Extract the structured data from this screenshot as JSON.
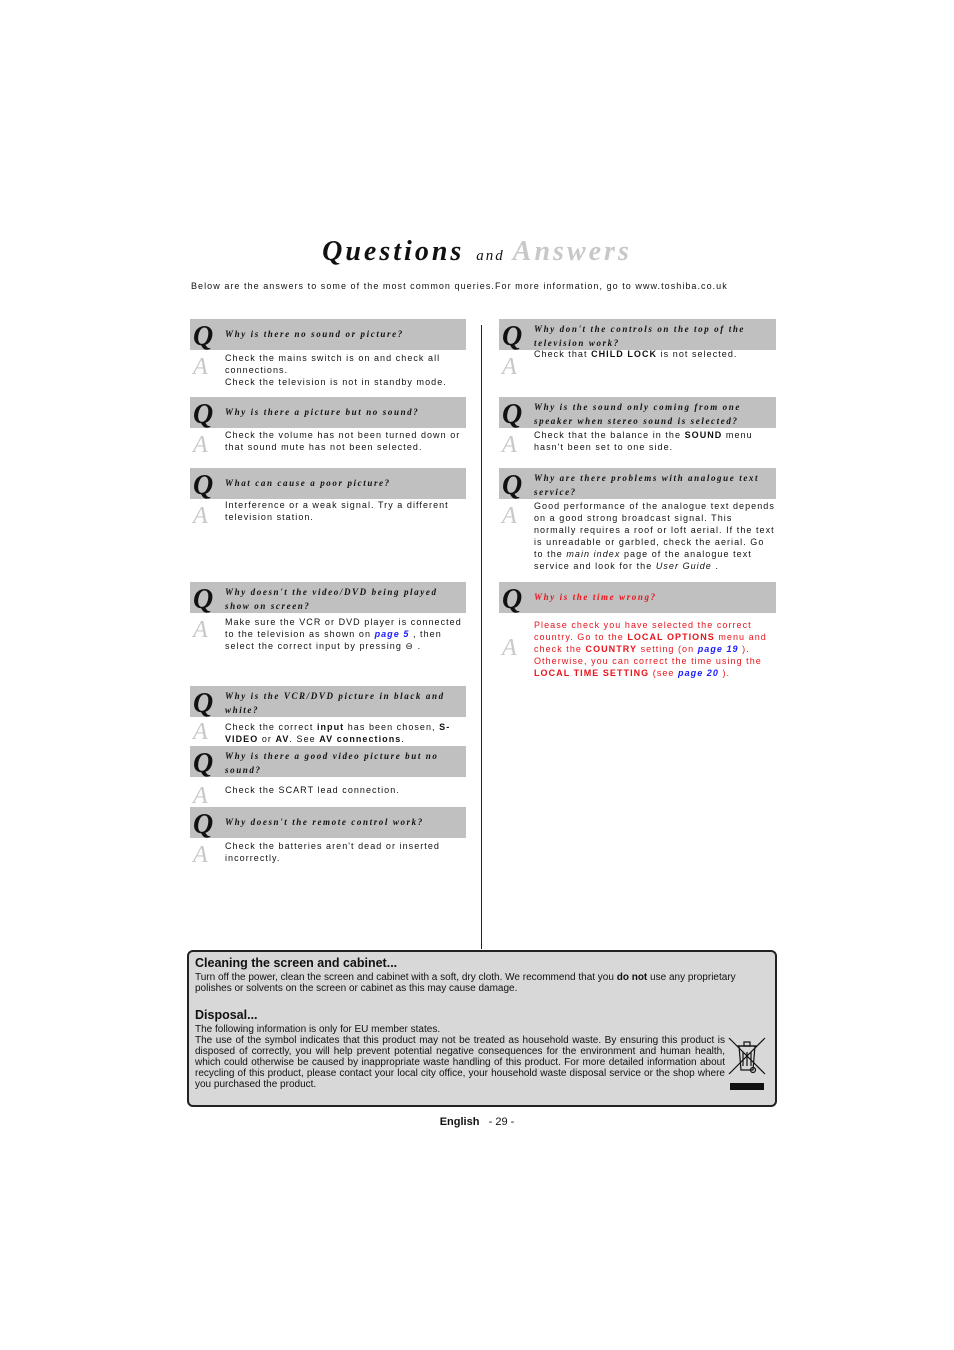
{
  "title": {
    "questions": "Questions",
    "and": "and",
    "answers": "Answers"
  },
  "intro": "Below are the answers to some of the most common queries.For more information, go to www.toshiba.co.uk",
  "qa_letters": {
    "q": "Q",
    "a": "A"
  },
  "left": [
    {
      "q": "Why is there no sound or picture?",
      "a": [
        {
          "t": "Check the mains switch is on and check all connections."
        },
        {
          "br": true
        },
        {
          "t": "Check the television is not in standby mode."
        }
      ]
    },
    {
      "q": "Why is there a picture but no sound?",
      "a": [
        {
          "t": "Check the volume has not been turned down or that sound mute has not been selected."
        }
      ]
    },
    {
      "q": "What can cause a poor picture?",
      "a": [
        {
          "t": "Interference or a weak signal. Try a different television station."
        }
      ]
    },
    {
      "q": "Why doesn't the video/DVD being played show on screen?",
      "a": [
        {
          "t": "Make sure the VCR or DVD player is connected to the television as shown on "
        },
        {
          "t": "page 5",
          "s": "link"
        },
        {
          "t": " , then select the correct input by pressing "
        },
        {
          "t": "⊖",
          "s": "icon"
        },
        {
          "t": " ."
        }
      ]
    },
    {
      "q": "Why is the VCR/DVD picture in black and white?",
      "a": [
        {
          "t": "Check the correct "
        },
        {
          "t": "input",
          "s": "b"
        },
        {
          "t": " has been chosen, "
        },
        {
          "t": "S-VIDEO",
          "s": "b"
        },
        {
          "t": " or "
        },
        {
          "t": "AV",
          "s": "b"
        },
        {
          "t": ". See "
        },
        {
          "t": "AV connections",
          "s": "b"
        },
        {
          "t": "."
        }
      ]
    },
    {
      "q": "Why is there a good video picture but no sound?",
      "a": [
        {
          "t": "Check the SCART lead connection."
        }
      ]
    },
    {
      "q": "Why doesn't the remote control work?",
      "a": [
        {
          "t": "Check the batteries aren't dead or inserted incorrectly."
        }
      ]
    }
  ],
  "right": [
    {
      "q": "Why don't the controls on the top of the television work?",
      "a": [
        {
          "t": "Check that "
        },
        {
          "t": "CHILD LOCK",
          "s": "b"
        },
        {
          "t": " is not selected."
        }
      ]
    },
    {
      "q": "Why is the sound only coming from one speaker when stereo sound is selected?",
      "a": [
        {
          "t": "Check that the balance in the "
        },
        {
          "t": "SOUND",
          "s": "b"
        },
        {
          "t": " menu hasn't been set to one side."
        }
      ]
    },
    {
      "q": "Why are there problems with analogue text service?",
      "a": [
        {
          "t": "Good performance of the analogue text depends on a good strong broadcast signal. This normally requires a roof or loft aerial. If the text is unreadable or garbled, check the aerial. Go to the "
        },
        {
          "t": "main index",
          "s": "i"
        },
        {
          "t": " page of the analogue text service and look for the "
        },
        {
          "t": "User Guide",
          "s": "i"
        },
        {
          "t": " ."
        }
      ]
    },
    {
      "q": "Why is the time wrong?",
      "red": true,
      "a": [
        {
          "t": "Please check you have selected the correct country.  Go to the "
        },
        {
          "t": "LOCAL OPTIONS",
          "s": "b"
        },
        {
          "t": " menu and check the "
        },
        {
          "t": "COUNTRY",
          "s": "b"
        },
        {
          "t": " setting (on "
        },
        {
          "t": "page 19",
          "s": "link"
        },
        {
          "t": " ). Otherwise, you can correct the time using the "
        },
        {
          "t": "LOCAL TIME SETTING",
          "s": "b"
        },
        {
          "t": " (see "
        },
        {
          "t": "page 20",
          "s": "link"
        },
        {
          "t": " )."
        }
      ]
    }
  ],
  "cleaning": {
    "heading": "Cleaning the screen and cabinet...",
    "text_before": "Turn off the power, clean the screen and cabinet with a soft, dry cloth. We recommend that you ",
    "text_bold": "do not",
    "text_after": " use any proprietary polishes or solvents on the screen or cabinet as this may cause damage."
  },
  "disposal": {
    "heading": "Disposal...",
    "line1": "The following information is only for EU member states.",
    "text": "The use of the symbol indicates that this product may not be treated as household waste. By ensuring this product is disposed of correctly, you will help prevent potential negative consequences for the environment and human health, which could otherwise be caused by inappropriate waste handling of this product. For more detailed information about recycling of this product, please contact your local city office, your household waste disposal service or the shop where you purchased the product.",
    "icon": "crossed-out-wheelie-bin-icon"
  },
  "footer": {
    "language": "English",
    "page": "- 29 -"
  },
  "colors": {
    "qbar": "#c0c0c0",
    "red_text": "#e8141c",
    "link": "#1a1aff",
    "box_bg": "#d8d8d8"
  }
}
